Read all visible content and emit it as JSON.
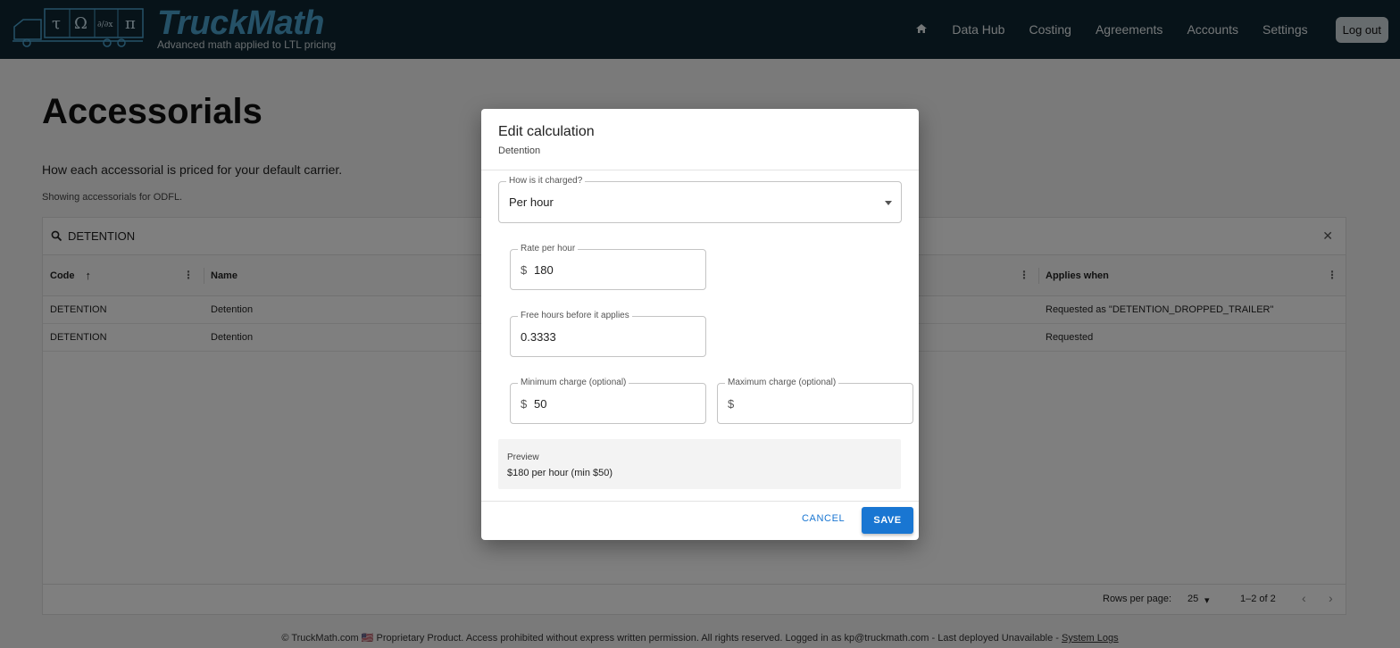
{
  "header": {
    "brand": "TruckMath",
    "tagline": "Advanced math applied to LTL pricing",
    "logo_symbols": [
      "τ",
      "Ω",
      "∂/∂x",
      "π"
    ],
    "nav": [
      "Data Hub",
      "Costing",
      "Agreements",
      "Accounts",
      "Settings"
    ],
    "logout": "Log out"
  },
  "page": {
    "title": "Accessorials",
    "description": "How each accessorial is priced for your default carrier.",
    "showing": "Showing accessorials for ODFL."
  },
  "grid": {
    "search_value": "DETENTION",
    "columns": [
      "Code",
      "Name",
      "Applies when"
    ],
    "rows": [
      {
        "code": "DETENTION",
        "name": "Detention",
        "applies": "Requested as \"DETENTION_DROPPED_TRAILER\""
      },
      {
        "code": "DETENTION",
        "name": "Detention",
        "applies": "Requested"
      }
    ],
    "rows_per_page_label": "Rows per page:",
    "rows_per_page": "25",
    "range": "1–2 of 2"
  },
  "dialog": {
    "title": "Edit calculation",
    "subtitle": "Detention",
    "charge_label": "How is it charged?",
    "charge_value": "Per hour",
    "rate_label": "Rate per hour",
    "rate_prefix": "$",
    "rate_value": "180",
    "free_label": "Free hours before it applies",
    "free_value": "0.3333",
    "min_label": "Minimum charge (optional)",
    "min_prefix": "$",
    "min_value": "50",
    "max_label": "Maximum charge (optional)",
    "max_prefix": "$",
    "max_value": "",
    "preview_label": "Preview",
    "preview_value": "$180 per hour (min $50)",
    "cancel": "CANCEL",
    "save": "SAVE"
  },
  "footer": {
    "copyright": "© TruckMath.com",
    "flag": "🇺🇸",
    "text": "Proprietary Product. Access prohibited without express written permission. All rights reserved. Logged in as kp@truckmath.com - Last deployed Unavailable -",
    "link": "System Logs"
  },
  "colors": {
    "header_bg": "#0f2733",
    "brand": "#4aa3cf",
    "primary": "#1976d2"
  }
}
